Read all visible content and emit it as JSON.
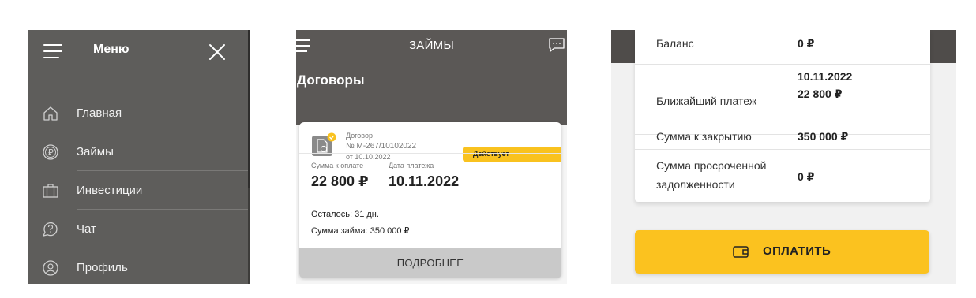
{
  "menu": {
    "title": "Меню",
    "items": [
      {
        "label": "Главная",
        "icon": "home-icon"
      },
      {
        "label": "Займы",
        "icon": "ruble-coin-icon"
      },
      {
        "label": "Инвестиции",
        "icon": "briefcase-icon"
      },
      {
        "label": "Чат",
        "icon": "chat-question-icon"
      },
      {
        "label": "Профиль",
        "icon": "user-icon"
      }
    ]
  },
  "loans": {
    "header_title": "ЗАЙМЫ",
    "section_title": "Договоры",
    "contract": {
      "label": "Договор",
      "number": "№ М-267/10102022",
      "date": "от 10.10.2022",
      "status": "Действует",
      "amount_label": "Сумма к оплате",
      "amount": "22 800 ₽",
      "payment_date_label": "Дата платежа",
      "payment_date": "10.11.2022",
      "remaining": "Осталось: 31 дн.",
      "loan_sum": "Сумма займа: 350 000 ₽",
      "more_button": "ПОДРОБНЕЕ"
    }
  },
  "details": {
    "rows": [
      {
        "key": "Баланс",
        "value": "0 ₽"
      },
      {
        "key": "Ближайший платеж",
        "value_line1": "10.11.2022",
        "value_line2": "22 800 ₽"
      },
      {
        "key": "Сумма к закрытию",
        "value": "350 000 ₽"
      },
      {
        "key_line1": "Сумма просроченной",
        "key_line2": "задолженности",
        "value": "0 ₽"
      }
    ],
    "pay_button": "ОПЛАТИТЬ"
  },
  "colors": {
    "accent": "#fbc21f",
    "menu_bg": "#5e5d5b",
    "header_bg": "#5b5856"
  }
}
